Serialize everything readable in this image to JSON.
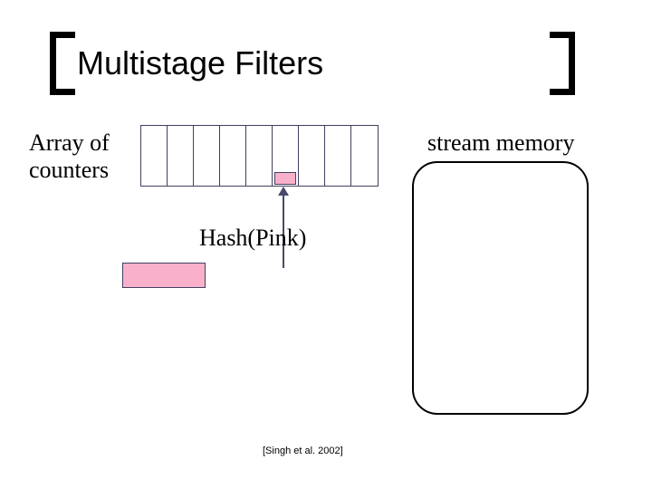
{
  "title": "Multistage Filters",
  "labels": {
    "array": "Array of\ncounters",
    "stream": "stream memory",
    "hash": "Hash(Pink)"
  },
  "counters": {
    "num_cells": 9,
    "highlighted_index": 5
  },
  "packet": {
    "color": "#f9b1cb"
  },
  "citation": "[Singh et al. 2002]"
}
